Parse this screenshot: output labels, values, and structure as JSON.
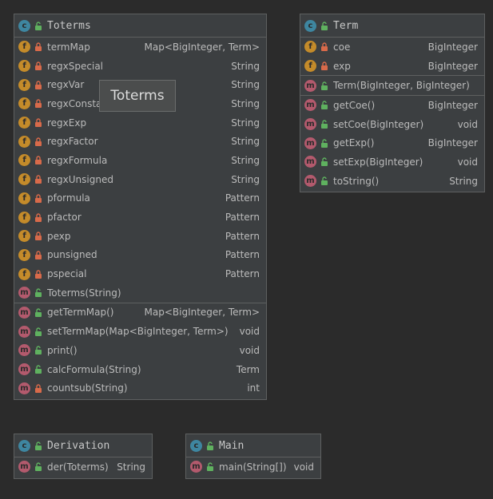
{
  "toterms": {
    "name": "Toterms",
    "fields": [
      {
        "name": "termMap",
        "type": "Map<BigInteger, Term>"
      },
      {
        "name": "regxSpecial",
        "type": "String"
      },
      {
        "name": "regxVar",
        "type": "String"
      },
      {
        "name": "regxConstant",
        "type": "String"
      },
      {
        "name": "regxExp",
        "type": "String"
      },
      {
        "name": "regxFactor",
        "type": "String"
      },
      {
        "name": "regxFormula",
        "type": "String"
      },
      {
        "name": "regxUnsigned",
        "type": "String"
      },
      {
        "name": "pformula",
        "type": "Pattern"
      },
      {
        "name": "pfactor",
        "type": "Pattern"
      },
      {
        "name": "pexp",
        "type": "Pattern"
      },
      {
        "name": "punsigned",
        "type": "Pattern"
      },
      {
        "name": "pspecial",
        "type": "Pattern"
      }
    ],
    "constructors": [
      {
        "name": "Toterms(String)",
        "type": ""
      }
    ],
    "methods": [
      {
        "name": "getTermMap()",
        "type": "Map<BigInteger, Term>",
        "visibility": "public"
      },
      {
        "name": "setTermMap(Map<BigInteger, Term>)",
        "type": "void",
        "visibility": "public"
      },
      {
        "name": "print()",
        "type": "void",
        "visibility": "public"
      },
      {
        "name": "calcFormula(String)",
        "type": "Term",
        "visibility": "public"
      },
      {
        "name": "countsub(String)",
        "type": "int",
        "visibility": "private"
      }
    ]
  },
  "term": {
    "name": "Term",
    "fields": [
      {
        "name": "coe",
        "type": "BigInteger"
      },
      {
        "name": "exp",
        "type": "BigInteger"
      }
    ],
    "constructors": [
      {
        "name": "Term(BigInteger, BigInteger)",
        "type": ""
      }
    ],
    "methods": [
      {
        "name": "getCoe()",
        "type": "BigInteger",
        "visibility": "public"
      },
      {
        "name": "setCoe(BigInteger)",
        "type": "void",
        "visibility": "public"
      },
      {
        "name": "getExp()",
        "type": "BigInteger",
        "visibility": "public"
      },
      {
        "name": "setExp(BigInteger)",
        "type": "void",
        "visibility": "public"
      },
      {
        "name": "toString()",
        "type": "String",
        "visibility": "public"
      }
    ]
  },
  "derivation": {
    "name": "Derivation",
    "methods": [
      {
        "name": "der(Toterms)",
        "type": "String",
        "visibility": "public"
      }
    ]
  },
  "main": {
    "name": "Main",
    "methods": [
      {
        "name": "main(String[])",
        "type": "void",
        "visibility": "public"
      }
    ]
  },
  "tooltip": "Toterms",
  "colors": {
    "background": "#2b2b2b",
    "panel": "#3c3f41",
    "class_icon": "#3e86a0",
    "field_icon": "#c48b2a",
    "method_icon": "#b35a6d",
    "lock_private": "#d86a4a",
    "lock_public": "#5fb15f"
  }
}
